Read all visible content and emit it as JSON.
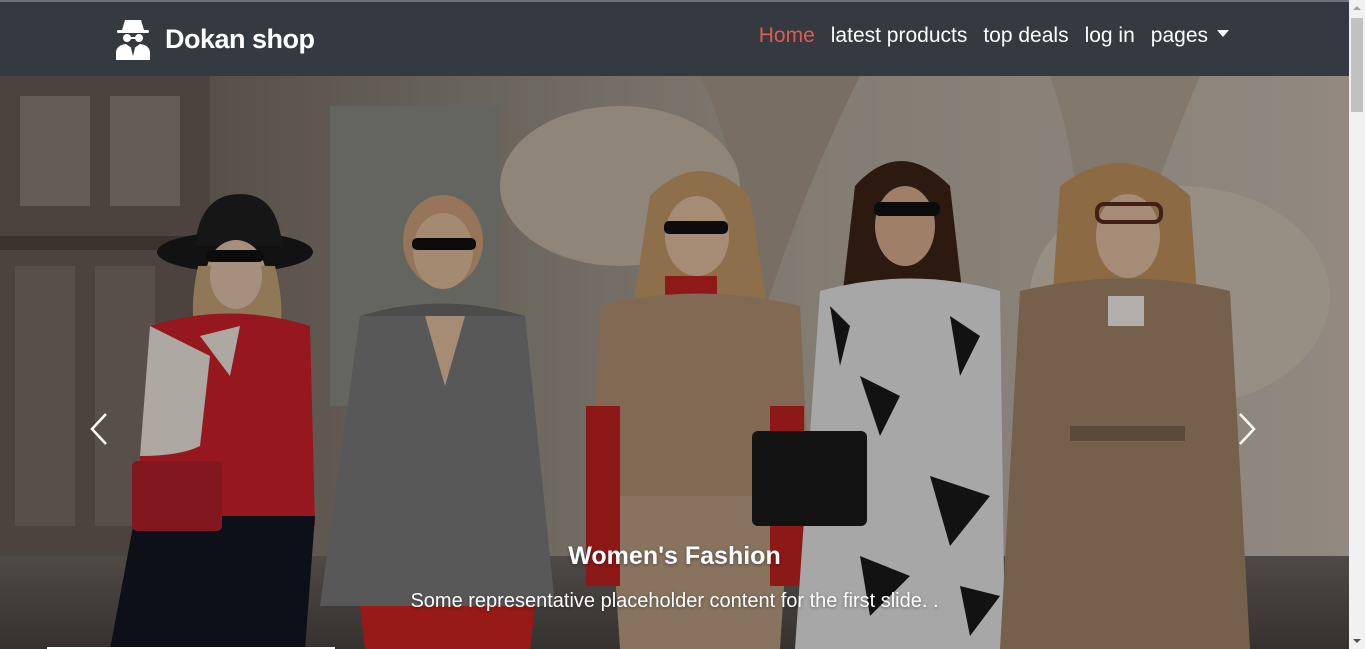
{
  "brand": {
    "name": "Dokan shop",
    "icon": "incognito-spy-icon"
  },
  "nav": {
    "items": [
      {
        "label": "Home",
        "active": true
      },
      {
        "label": "latest products",
        "active": false
      },
      {
        "label": "top deals",
        "active": false
      },
      {
        "label": "log in",
        "active": false
      },
      {
        "label": "pages",
        "active": false,
        "dropdown": true
      }
    ]
  },
  "carousel": {
    "caption_title": "Women's Fashion",
    "caption_text": "Some representative placeholder content for the first slide. .",
    "prev_icon": "chevron-left-icon",
    "next_icon": "chevron-right-icon"
  },
  "colors": {
    "navbar_bg": "#343a40",
    "active_link": "#e05a4e",
    "link": "#ffffff"
  }
}
